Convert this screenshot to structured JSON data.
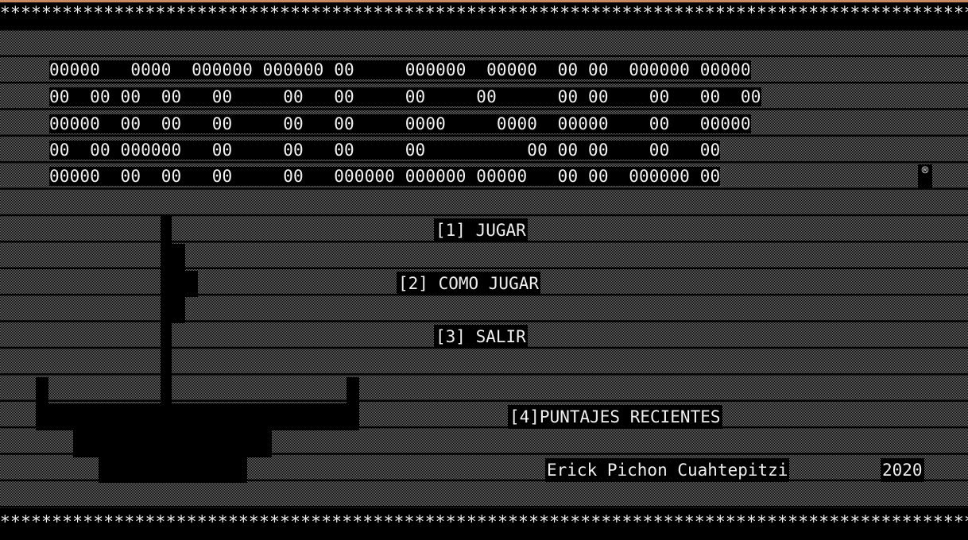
{
  "border": {
    "top": "*****************************************************************************************************************",
    "bottom": "*****************************************************************************************************************"
  },
  "banner": {
    "rows": [
      [
        "00000   0000  000000 000000 00     000000  00000  00 00  000000 00000"
      ],
      [
        "00  00 00  00   00     00   00     00     00      00 00    00   00  00"
      ],
      [
        "00000  00  00   00     00   00     0000     0000  00000    00   00000"
      ],
      [
        "00  00 000000   00     00   00     00          00 00 00    00   00"
      ],
      [
        "00000  00  00   00     00   000000 000000 00000   00 00  000000 00"
      ]
    ],
    "row_text": [
      "00000   0000  000000 000000 00     000000  00000  00 00  000000 00000",
      "00  00 00  00   00     00   00     00     00      00 00    00   00  00",
      "00000  00  00   00     00   00     0000     0000  00000    00   00000",
      "00  00 000000   00     00   00     00          00 00 00    00   00",
      "00000  00  00   00     00   000000 000000 00000   00 00  000000 00"
    ],
    "registered_mark": "®"
  },
  "menu": {
    "play": "[1] JUGAR",
    "how_to_play": "[2] COMO JUGAR",
    "exit": "[3] SALIR",
    "recent_scores": "[4]PUNTAJES RECIENTES"
  },
  "credits": {
    "author": "Erick Pichon Cuahtepitzi",
    "year": "2020"
  }
}
